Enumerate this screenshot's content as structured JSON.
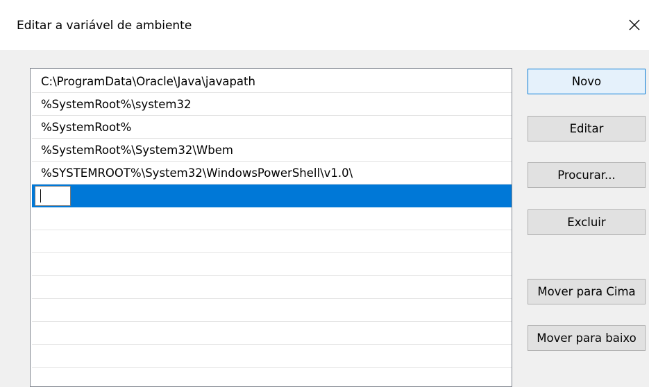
{
  "window": {
    "title": "Editar a variável de ambiente",
    "close_icon": "close-icon"
  },
  "list": {
    "items": [
      "C:\\ProgramData\\Oracle\\Java\\javapath",
      "%SystemRoot%\\system32",
      "%SystemRoot%",
      "%SystemRoot%\\System32\\Wbem",
      "%SYSTEMROOT%\\System32\\WindowsPowerShell\\v1.0\\"
    ],
    "editing_value": ""
  },
  "buttons": {
    "new": "Novo",
    "edit": "Editar",
    "browse": "Procurar...",
    "delete": "Excluir",
    "move_up": "Mover para Cima",
    "move_down": "Mover para baixo"
  },
  "colors": {
    "selection": "#0078d7",
    "default_button_border": "#0078d7"
  }
}
